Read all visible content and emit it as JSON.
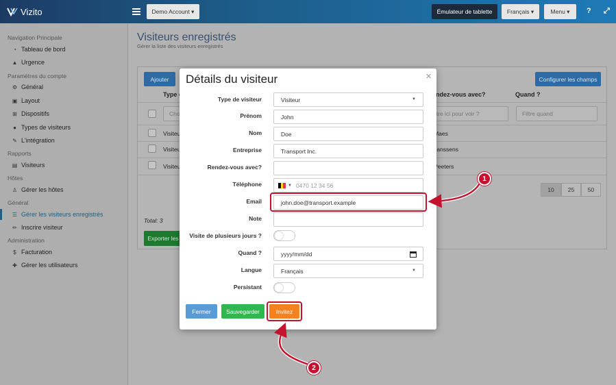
{
  "app": {
    "name": "Vizito"
  },
  "topbar": {
    "account_label": "Demo Account ▾",
    "tablet_label": "Émulateur de tablette",
    "language_label": "Français ▾",
    "menu_label": "Menu ▾",
    "help_icon": "question-icon",
    "expand_icon": "expand-icon"
  },
  "sidebar": {
    "sections": [
      {
        "title": "Navigation Principale"
      },
      {
        "title": "Paramètres du compte"
      },
      {
        "title": "Rapports"
      },
      {
        "title": "Hôtes"
      },
      {
        "title": "Général"
      },
      {
        "title": "Administration"
      }
    ],
    "items": [
      {
        "label": "Tableau de bord",
        "icon": "dashboard-icon"
      },
      {
        "label": "Urgence",
        "icon": "warning-icon"
      },
      {
        "label": "Général",
        "icon": "gear-icon"
      },
      {
        "label": "Layout",
        "icon": "image-icon"
      },
      {
        "label": "Dispositifs",
        "icon": "sitemap-icon"
      },
      {
        "label": "Types de visiteurs",
        "icon": "users-icon"
      },
      {
        "label": "L'intégration",
        "icon": "wrench-icon"
      },
      {
        "label": "Visiteurs",
        "icon": "table-icon"
      },
      {
        "label": "Gérer les hôtes",
        "icon": "host-icon"
      },
      {
        "label": "Gérer les visiteurs enregistrés",
        "icon": "list-icon"
      },
      {
        "label": "Inscrire visiteur",
        "icon": "pencil-icon"
      },
      {
        "label": "Facturation",
        "icon": "dollar-icon"
      },
      {
        "label": "Gérer les utilisateurs",
        "icon": "user-plus-icon"
      }
    ]
  },
  "main": {
    "title": "Visiteurs enregistrés",
    "subtitle": "Gérer la liste des visiteurs enregistrés",
    "add_label": "Ajouter",
    "configure_label": "Configurer les champs",
    "export_label": "Exporter les",
    "total_label": "Total: 3",
    "columns": [
      "Type d",
      "ndez-vous avec?",
      "Quand ?"
    ],
    "filters": {
      "type": "Cho",
      "host": "iltre ici pour voir ?",
      "when": "Filtre quand"
    },
    "rows": [
      {
        "type": "Visiteur",
        "host": "e Maes"
      },
      {
        "type": "Visiteur",
        "host": "d Janssens"
      },
      {
        "type": "Visiteur",
        "host": "n Peeters"
      }
    ],
    "pages": [
      "10",
      "25",
      "50"
    ]
  },
  "modal": {
    "title": "Détails du visiteur",
    "close_symbol": "×",
    "fields": {
      "type": {
        "label": "Type de visiteur",
        "value": "Visiteur"
      },
      "firstname": {
        "label": "Prénom",
        "value": "John"
      },
      "lastname": {
        "label": "Nom",
        "value": "Doe"
      },
      "company": {
        "label": "Entreprise",
        "value": "Transport Inc."
      },
      "host": {
        "label": "Rendez-vous avec?",
        "value": ""
      },
      "phone": {
        "label": "Téléphone",
        "placeholder": "0470 12 34 56"
      },
      "email": {
        "label": "Email",
        "value": "john.doe@transport.example"
      },
      "note": {
        "label": "Note",
        "value": ""
      },
      "multiday": {
        "label": "Visite de plusieurs jours ?"
      },
      "when": {
        "label": "Quand ?",
        "placeholder": "yyyy/mm/dd"
      },
      "language": {
        "label": "Langue",
        "value": "Français"
      },
      "persistent": {
        "label": "Persistant"
      }
    },
    "buttons": {
      "close": "Fermer",
      "save": "Sauvegarder",
      "invite": "Invitez"
    }
  },
  "callouts": [
    "1",
    "2"
  ],
  "colors": {
    "callout": "#c4122f",
    "btn_close": "#5b9bd5",
    "btn_save": "#2eb84f",
    "btn_invite": "#f58220"
  }
}
